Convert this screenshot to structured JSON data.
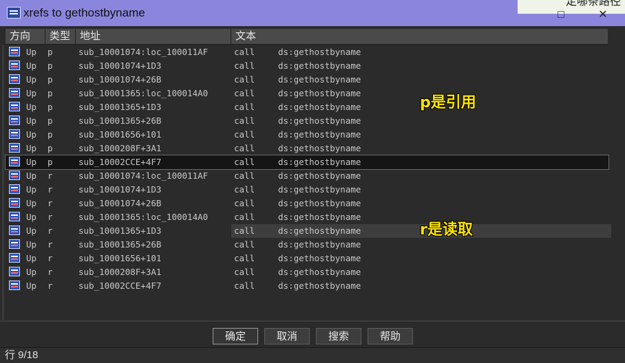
{
  "window": {
    "title": "xrefs to gethostbyname",
    "overlay_text": "定哪条路径"
  },
  "columns": [
    "方向",
    "类型",
    "地址",
    "文本"
  ],
  "rows": [
    {
      "dir": "Up",
      "type": "p",
      "addr": "sub_10001074:loc_100011AF",
      "op": "call",
      "arg": "ds:gethostbyname"
    },
    {
      "dir": "Up",
      "type": "p",
      "addr": "sub_10001074+1D3",
      "op": "call",
      "arg": "ds:gethostbyname"
    },
    {
      "dir": "Up",
      "type": "p",
      "addr": "sub_10001074+26B",
      "op": "call",
      "arg": "ds:gethostbyname"
    },
    {
      "dir": "Up",
      "type": "p",
      "addr": "sub_10001365:loc_100014A0",
      "op": "call",
      "arg": "ds:gethostbyname"
    },
    {
      "dir": "Up",
      "type": "p",
      "addr": "sub_10001365+1D3",
      "op": "call",
      "arg": "ds:gethostbyname"
    },
    {
      "dir": "Up",
      "type": "p",
      "addr": "sub_10001365+26B",
      "op": "call",
      "arg": "ds:gethostbyname"
    },
    {
      "dir": "Up",
      "type": "p",
      "addr": "sub_10001656+101",
      "op": "call",
      "arg": "ds:gethostbyname"
    },
    {
      "dir": "Up",
      "type": "p",
      "addr": "sub_1000208F+3A1",
      "op": "call",
      "arg": "ds:gethostbyname"
    },
    {
      "dir": "Up",
      "type": "p",
      "addr": "sub_10002CCE+4F7",
      "op": "call",
      "arg": "ds:gethostbyname"
    },
    {
      "dir": "Up",
      "type": "r",
      "addr": "sub_10001074:loc_100011AF",
      "op": "call",
      "arg": "ds:gethostbyname"
    },
    {
      "dir": "Up",
      "type": "r",
      "addr": "sub_10001074+1D3",
      "op": "call",
      "arg": "ds:gethostbyname"
    },
    {
      "dir": "Up",
      "type": "r",
      "addr": "sub_10001074+26B",
      "op": "call",
      "arg": "ds:gethostbyname"
    },
    {
      "dir": "Up",
      "type": "r",
      "addr": "sub_10001365:loc_100014A0",
      "op": "call",
      "arg": "ds:gethostbyname"
    },
    {
      "dir": "Up",
      "type": "r",
      "addr": "sub_10001365+1D3",
      "op": "call",
      "arg": "ds:gethostbyname"
    },
    {
      "dir": "Up",
      "type": "r",
      "addr": "sub_10001365+26B",
      "op": "call",
      "arg": "ds:gethostbyname"
    },
    {
      "dir": "Up",
      "type": "r",
      "addr": "sub_10001656+101",
      "op": "call",
      "arg": "ds:gethostbyname"
    },
    {
      "dir": "Up",
      "type": "r",
      "addr": "sub_1000208F+3A1",
      "op": "call",
      "arg": "ds:gethostbyname"
    },
    {
      "dir": "Up",
      "type": "r",
      "addr": "sub_10002CCE+4F7",
      "op": "call",
      "arg": "ds:gethostbyname"
    }
  ],
  "selected_row": 8,
  "highlight_row": 13,
  "buttons": {
    "ok": "确定",
    "cancel": "取消",
    "search": "搜索",
    "help": "帮助"
  },
  "status": "行 9/18",
  "annotations": {
    "p_note": "p是引用",
    "r_note": "r是读取"
  },
  "colors": {
    "titlebar": "#8b86dd",
    "annotation": "#ffe400"
  }
}
